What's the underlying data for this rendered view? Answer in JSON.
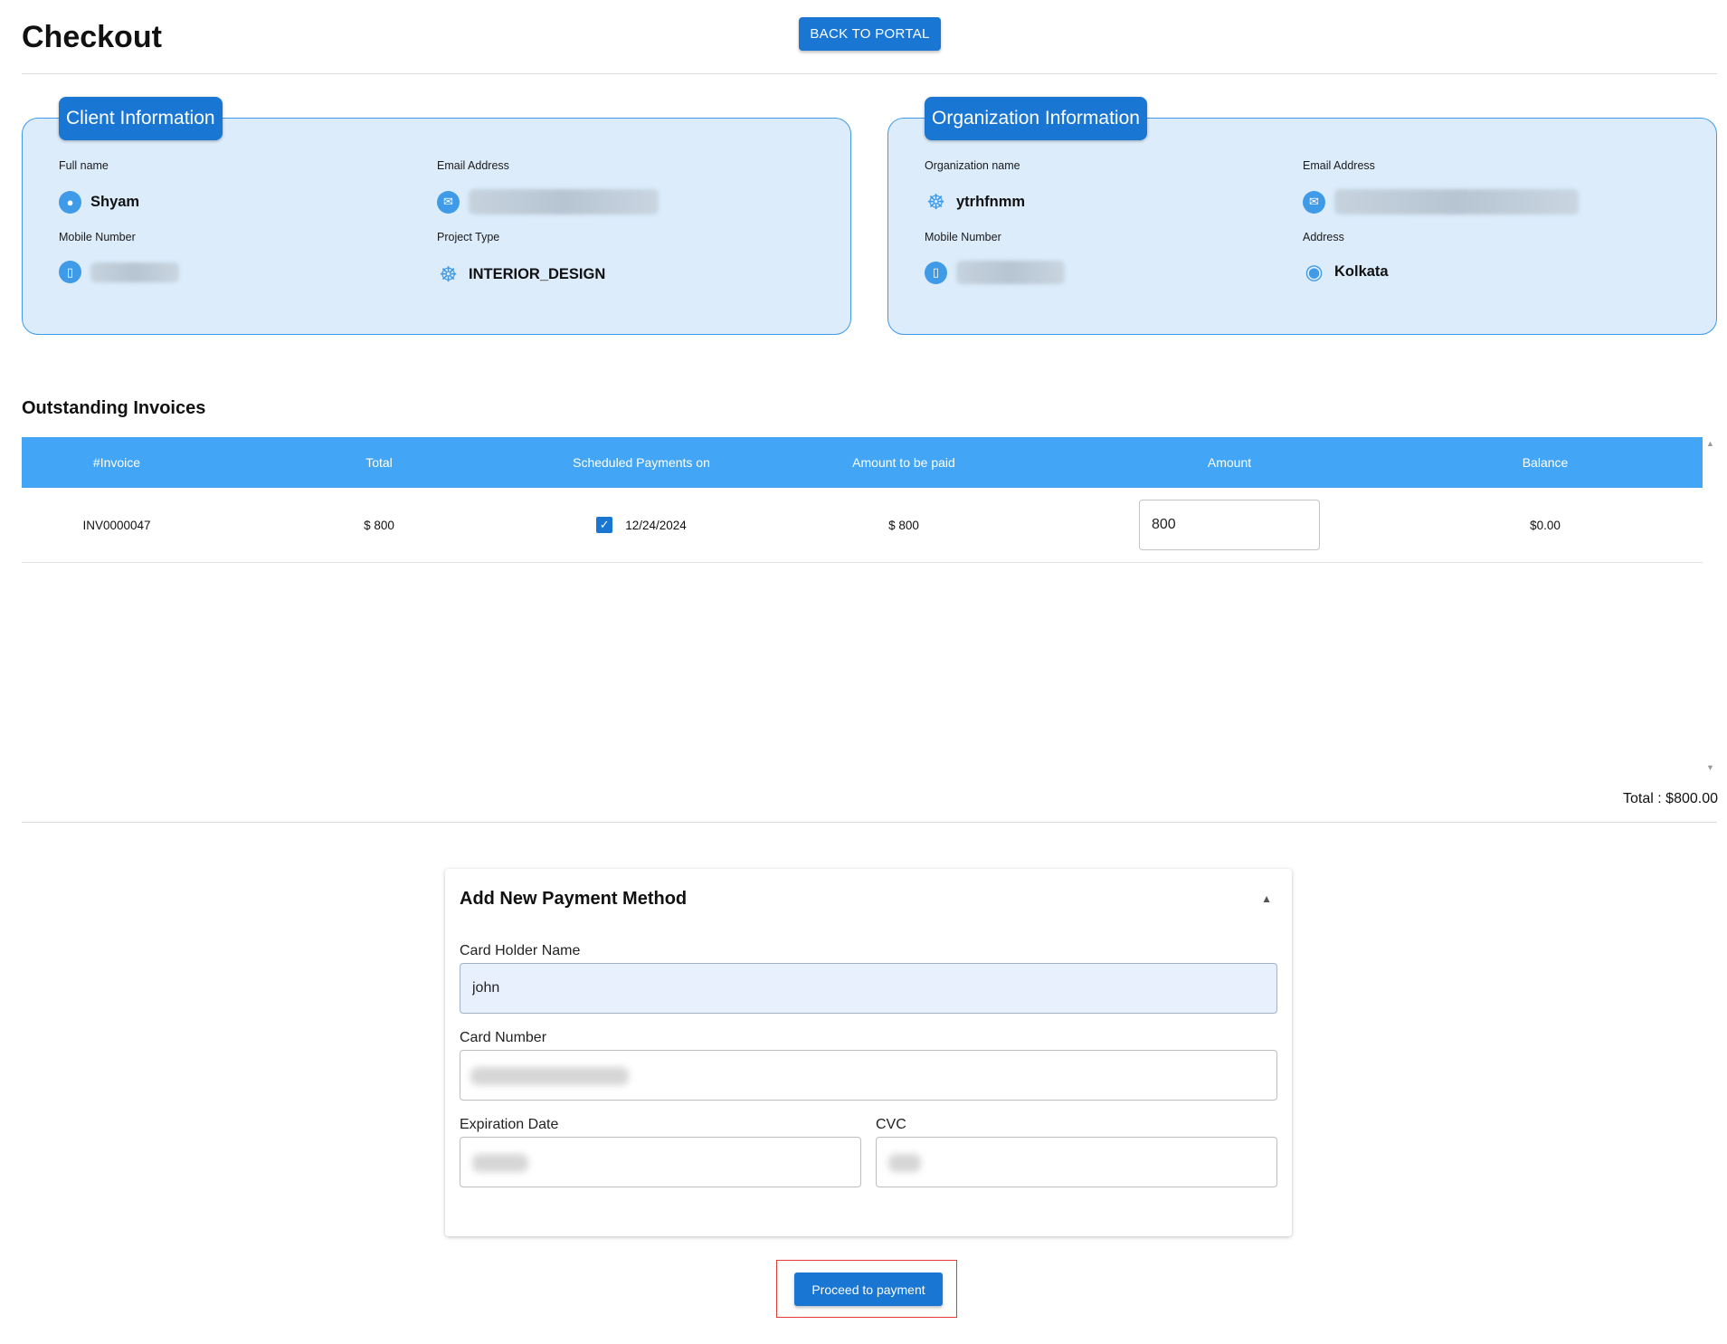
{
  "header": {
    "title": "Checkout",
    "back_label": "BACK TO PORTAL"
  },
  "client": {
    "heading": "Client Information",
    "full_name_label": "Full name",
    "full_name": "Shyam",
    "email_label": "Email Address",
    "mobile_label": "Mobile Number",
    "project_label": "Project Type",
    "project_type": "INTERIOR_DESIGN"
  },
  "organization": {
    "heading": "Organization Information",
    "name_label": "Organization name",
    "name": "ytrhfnmm",
    "email_label": "Email Address",
    "mobile_label": "Mobile Number",
    "address_label": "Address",
    "address": "Kolkata"
  },
  "invoices": {
    "title": "Outstanding Invoices",
    "columns": [
      "#Invoice",
      "Total",
      "Scheduled Payments on",
      "Amount to be paid",
      "Amount",
      "Balance"
    ],
    "rows": [
      {
        "invoice": "INV0000047",
        "total": "$ 800",
        "scheduled": "12/24/2024",
        "to_pay": "$ 800",
        "amount": "800",
        "balance": "$0.00"
      }
    ],
    "total_line": "Total : $800.00"
  },
  "payment": {
    "title": "Add New Payment Method",
    "holder_label": "Card Holder Name",
    "holder_value": "john",
    "number_label": "Card Number",
    "expiry_label": "Expiration Date",
    "cvc_label": "CVC"
  },
  "proceed_label": "Proceed to payment",
  "icons": {
    "user": "user-icon",
    "mail": "mail-icon",
    "phone": "phone-icon",
    "building": "building-icon",
    "location": "location-pin-icon"
  },
  "colors": {
    "primary": "#1976d2",
    "table_header": "#42a5f5",
    "card_bg": "#dcecfb",
    "highlight": "#e53935"
  }
}
